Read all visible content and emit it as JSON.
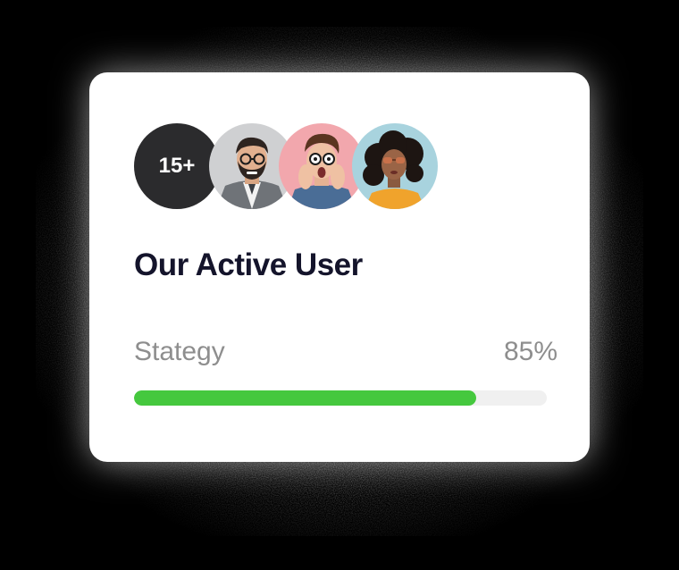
{
  "card": {
    "count_badge": "15+",
    "title": "Our Active User",
    "avatars": [
      {
        "icon": "man-with-glasses-beard-avatar"
      },
      {
        "icon": "surprised-man-avatar"
      },
      {
        "icon": "woman-with-sunglasses-avatar"
      }
    ]
  },
  "progress": {
    "label": "Stategy",
    "value_text": "85%",
    "fraction": 0.83
  },
  "colors": {
    "background": "#000000",
    "card": "#ffffff",
    "count_badge": "#2b2b2d",
    "title": "#14142b",
    "muted_text": "#8e8e8e",
    "progress_fill": "#45c83e",
    "progress_track": "#f0f0f0",
    "avatar2_bg": "#f2a7ad",
    "avatar3_bg": "#a8d3de"
  }
}
